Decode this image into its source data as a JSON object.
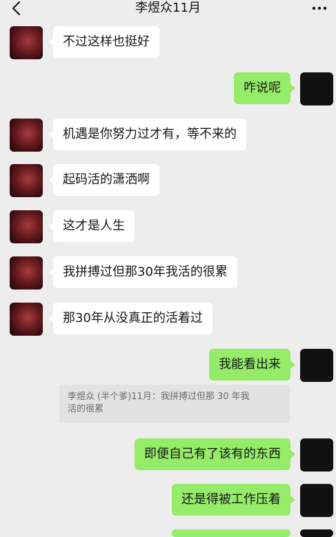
{
  "header": {
    "title": "李煜众11月",
    "back_icon": "chevron-left-icon",
    "more_icon": "more-dots-icon"
  },
  "messages": [
    {
      "from": "other",
      "text": "不过这样也挺好"
    },
    {
      "from": "self",
      "text": "咋说呢"
    },
    {
      "from": "other",
      "text": "机遇是你努力过才有，等不来的"
    },
    {
      "from": "other",
      "text": "起码活的潇洒啊"
    },
    {
      "from": "other",
      "text": "这才是人生"
    },
    {
      "from": "other",
      "text": "我拼搏过但那30年我活的很累"
    },
    {
      "from": "other",
      "text": "那30年从没真正的活着过"
    },
    {
      "from": "self",
      "text": "我能看出来"
    },
    {
      "from": "self",
      "text": "即便自己有了该有的东西"
    },
    {
      "from": "self",
      "text": "还是得被工作压着"
    }
  ],
  "quote": {
    "line1": "李煜众 (半个爹)11月：我拼搏过但那 30 年我",
    "line2": "活的很累"
  },
  "colors": {
    "background": "#ededed",
    "bubble_self": "#95ec69",
    "bubble_other": "#ffffff",
    "quote_bg": "#e2e2e2",
    "avatar_self": "#111111"
  }
}
